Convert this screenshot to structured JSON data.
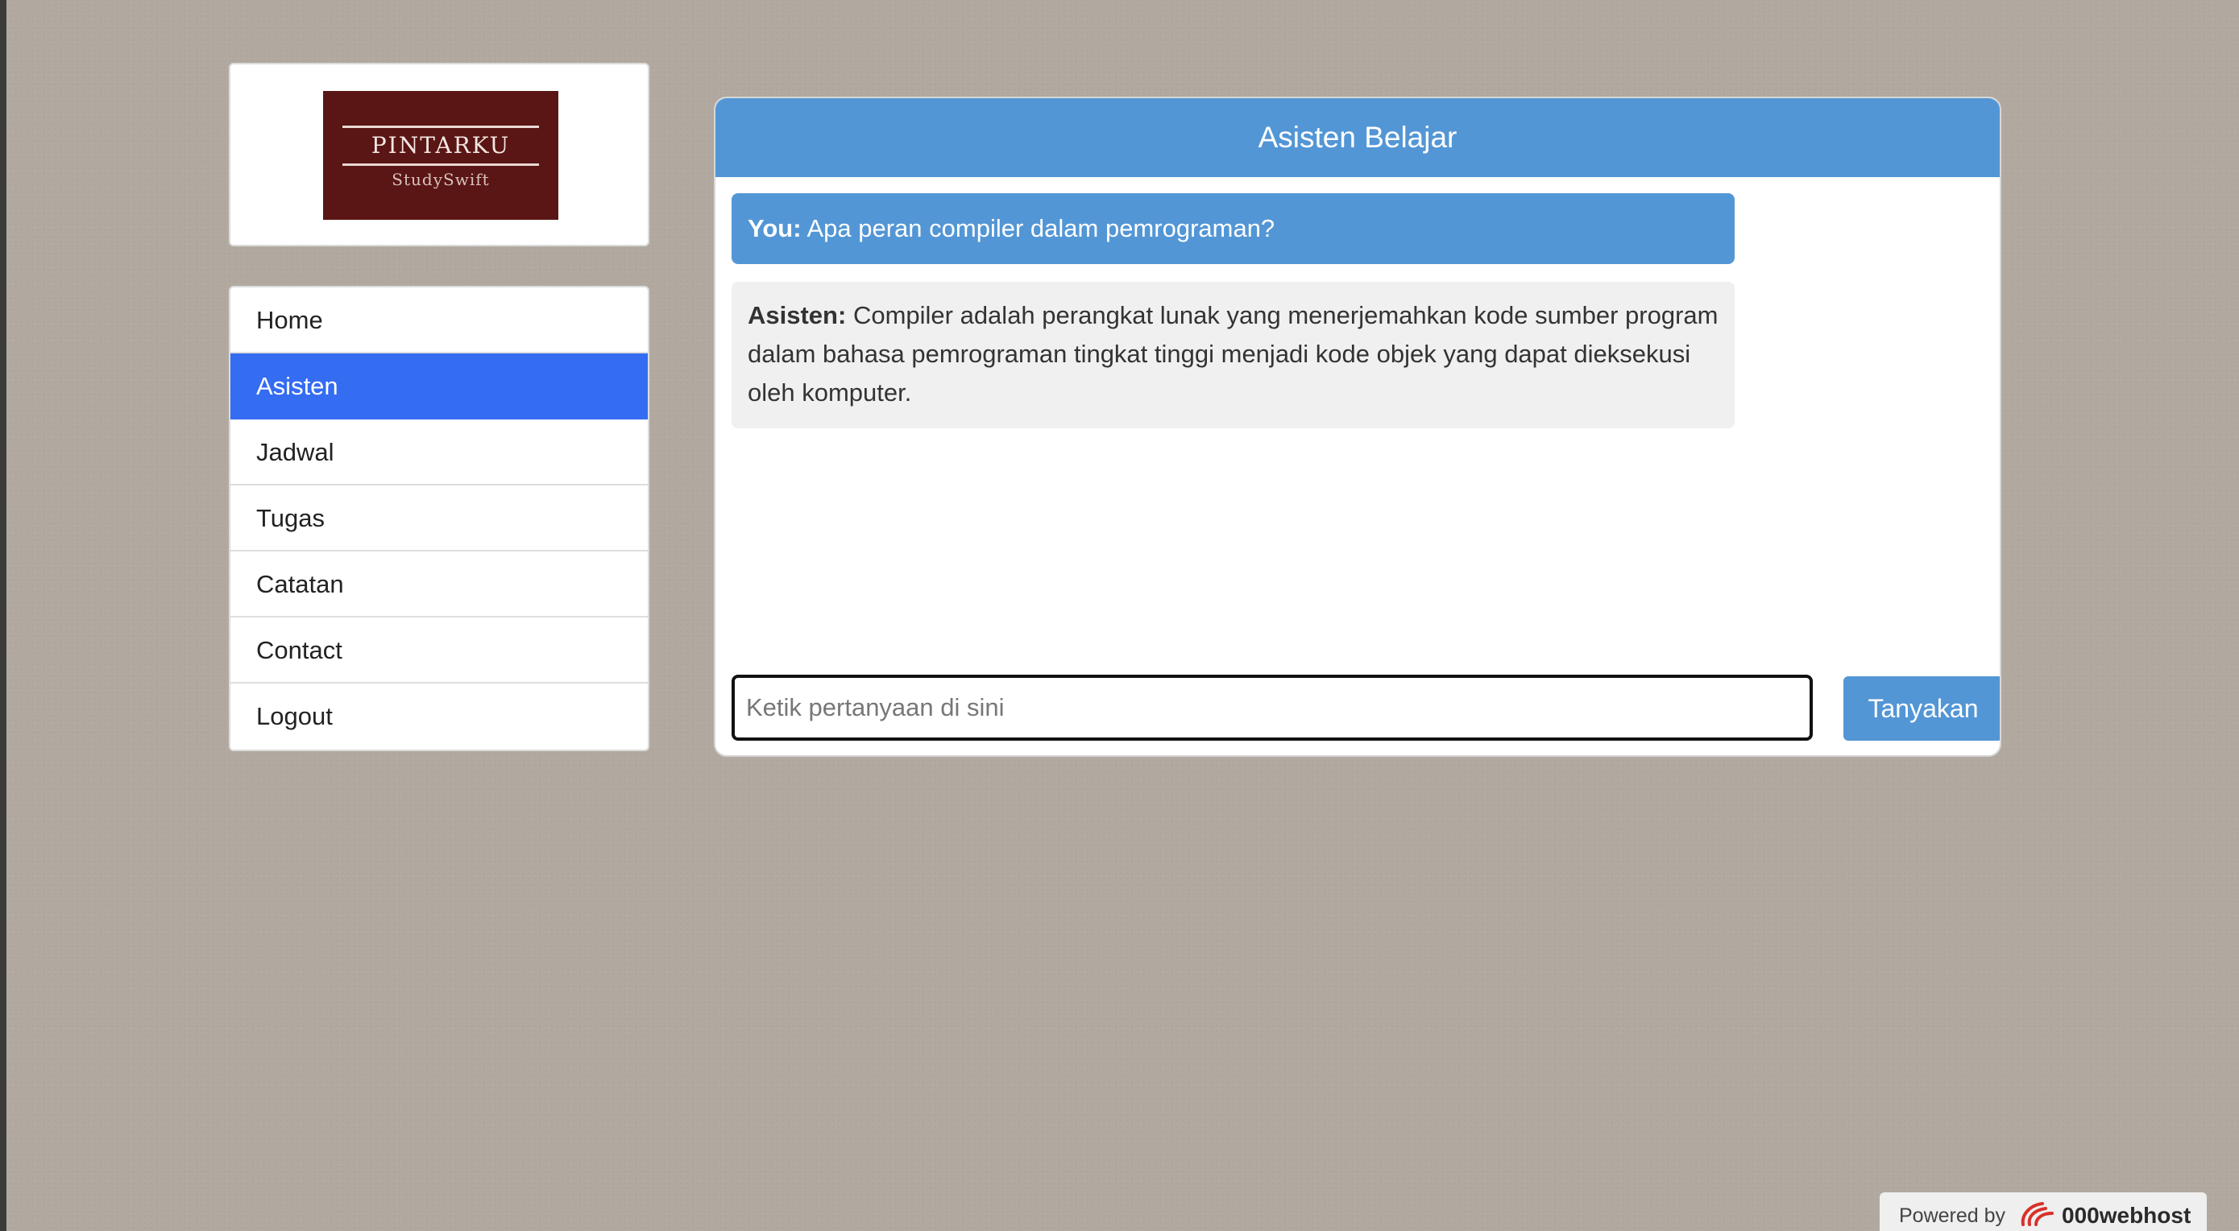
{
  "brand": {
    "name": "PINTARKU",
    "tagline": "StudySwift",
    "color": "#5a1515"
  },
  "nav": {
    "items": [
      {
        "label": "Home",
        "active": false
      },
      {
        "label": "Asisten",
        "active": true
      },
      {
        "label": "Jadwal",
        "active": false
      },
      {
        "label": "Tugas",
        "active": false
      },
      {
        "label": "Catatan",
        "active": false
      },
      {
        "label": "Contact",
        "active": false
      },
      {
        "label": "Logout",
        "active": false
      }
    ],
    "active_color": "#346cf2"
  },
  "chat": {
    "title": "Asisten Belajar",
    "accent_color": "#5396d5",
    "messages": [
      {
        "speaker": "You:",
        "text": "Apa peran compiler dalam pemrograman?"
      },
      {
        "speaker": "Asisten:",
        "text": "Compiler adalah perangkat lunak yang menerjemahkan kode sumber program dalam bahasa pemrograman tingkat tinggi menjadi kode objek yang dapat dieksekusi oleh komputer."
      }
    ],
    "input": {
      "placeholder": "Ketik pertanyaan di sini",
      "value": ""
    },
    "submit_label": "Tanyakan"
  },
  "footer": {
    "powered_label": "Powered by",
    "host_name": "000webhost",
    "host_icon": "000webhost-logo-icon"
  }
}
